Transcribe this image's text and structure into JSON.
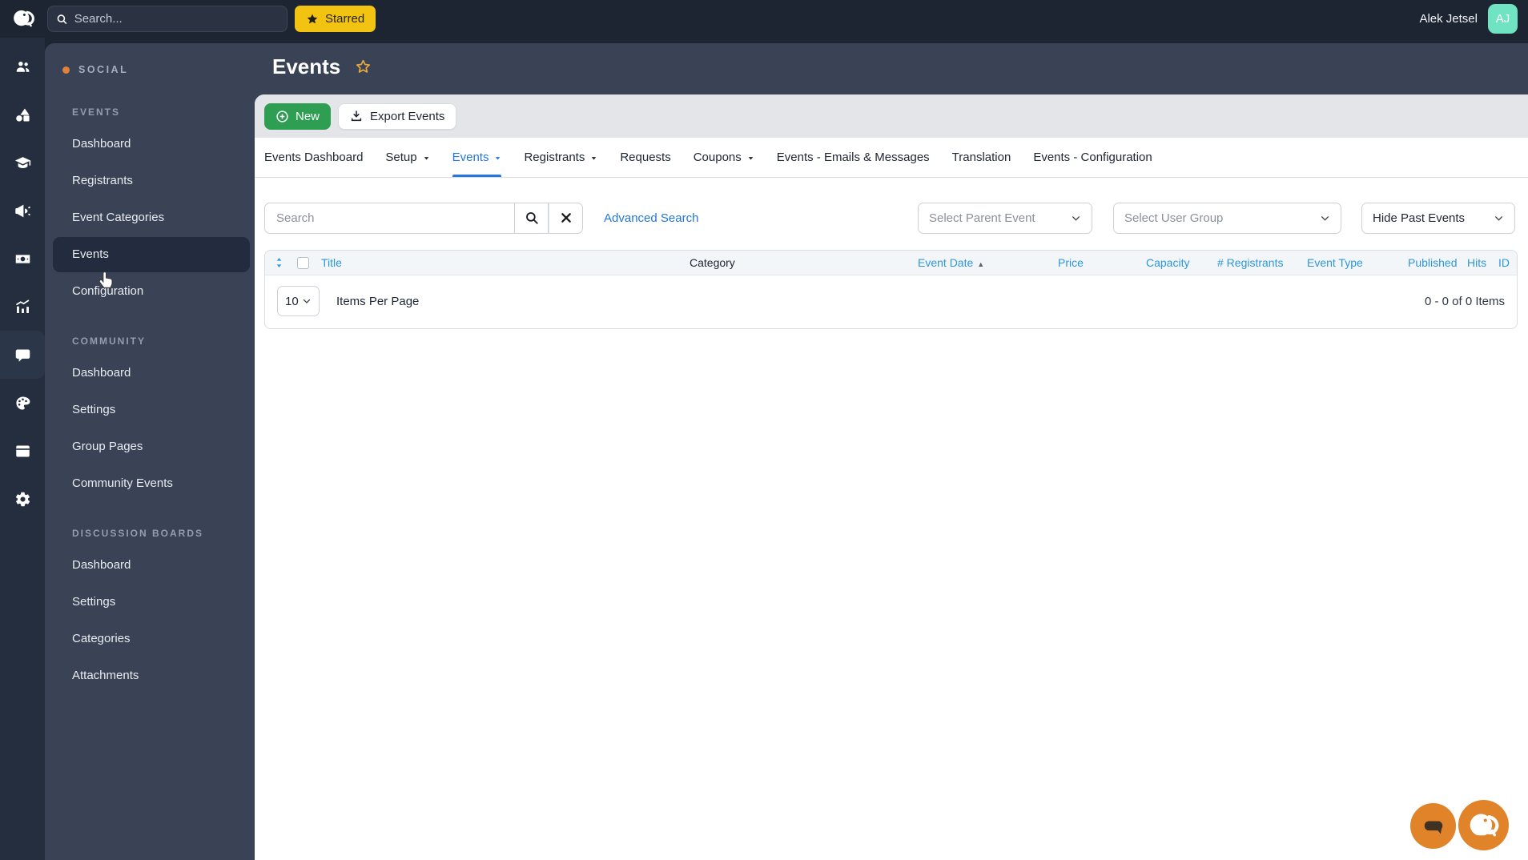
{
  "topbar": {
    "search_placeholder": "Search...",
    "starred_label": "Starred",
    "user_name": "Alek Jetsel",
    "user_initials": "AJ"
  },
  "page": {
    "title": "Events"
  },
  "sidebar": {
    "brand": "SOCIAL",
    "sections": [
      {
        "title": "EVENTS",
        "items": [
          "Dashboard",
          "Registrants",
          "Event Categories",
          "Events",
          "Configuration"
        ]
      },
      {
        "title": "COMMUNITY",
        "items": [
          "Dashboard",
          "Settings",
          "Group Pages",
          "Community Events"
        ]
      },
      {
        "title": "DISCUSSION BOARDS",
        "items": [
          "Dashboard",
          "Settings",
          "Categories",
          "Attachments"
        ]
      }
    ],
    "active_item": "Events"
  },
  "rail_icons": [
    "users",
    "shapes",
    "graduation-cap",
    "megaphone",
    "money",
    "analytics",
    "chat",
    "palette",
    "window",
    "settings"
  ],
  "toolbar": {
    "new_label": "New",
    "export_label": "Export Events"
  },
  "tabs": {
    "items": [
      "Events Dashboard",
      "Setup",
      "Events",
      "Registrants",
      "Requests",
      "Coupons",
      "Events - Emails & Messages",
      "Translation",
      "Events - Configuration"
    ],
    "active": "Events",
    "with_caret": [
      "Setup",
      "Events",
      "Registrants",
      "Coupons"
    ]
  },
  "filters": {
    "search_placeholder": "Search",
    "advanced_search_label": "Advanced Search",
    "parent_event_placeholder": "Select Parent Event",
    "user_group_placeholder": "Select User Group",
    "past_events_value": "Hide Past Events"
  },
  "table": {
    "columns": [
      "Title",
      "Category",
      "Event Date",
      "Price",
      "Capacity",
      "# Registrants",
      "Event Type",
      "Published",
      "Hits",
      "ID"
    ],
    "sorted_by": "Event Date",
    "sort_direction": "asc",
    "sort_indicator": "▲",
    "rows": []
  },
  "pagination": {
    "per_page": "10",
    "per_page_label": "Items Per Page",
    "count_text": "0 - 0 of 0 Items"
  },
  "colors": {
    "topbar_bg": "#1d2533",
    "rail_bg": "#242e3f",
    "sidebar_bg": "#3a4355",
    "sidebar_active_bg": "#232c3e",
    "accent_orange": "#e0823c",
    "accent_yellow": "#f2c411",
    "accent_green": "#2d9e52",
    "link_blue": "#2277e0",
    "table_header_blue": "#2e96db",
    "avatar_teal": "#6fe3c2",
    "widget_orange": "#e08329"
  }
}
